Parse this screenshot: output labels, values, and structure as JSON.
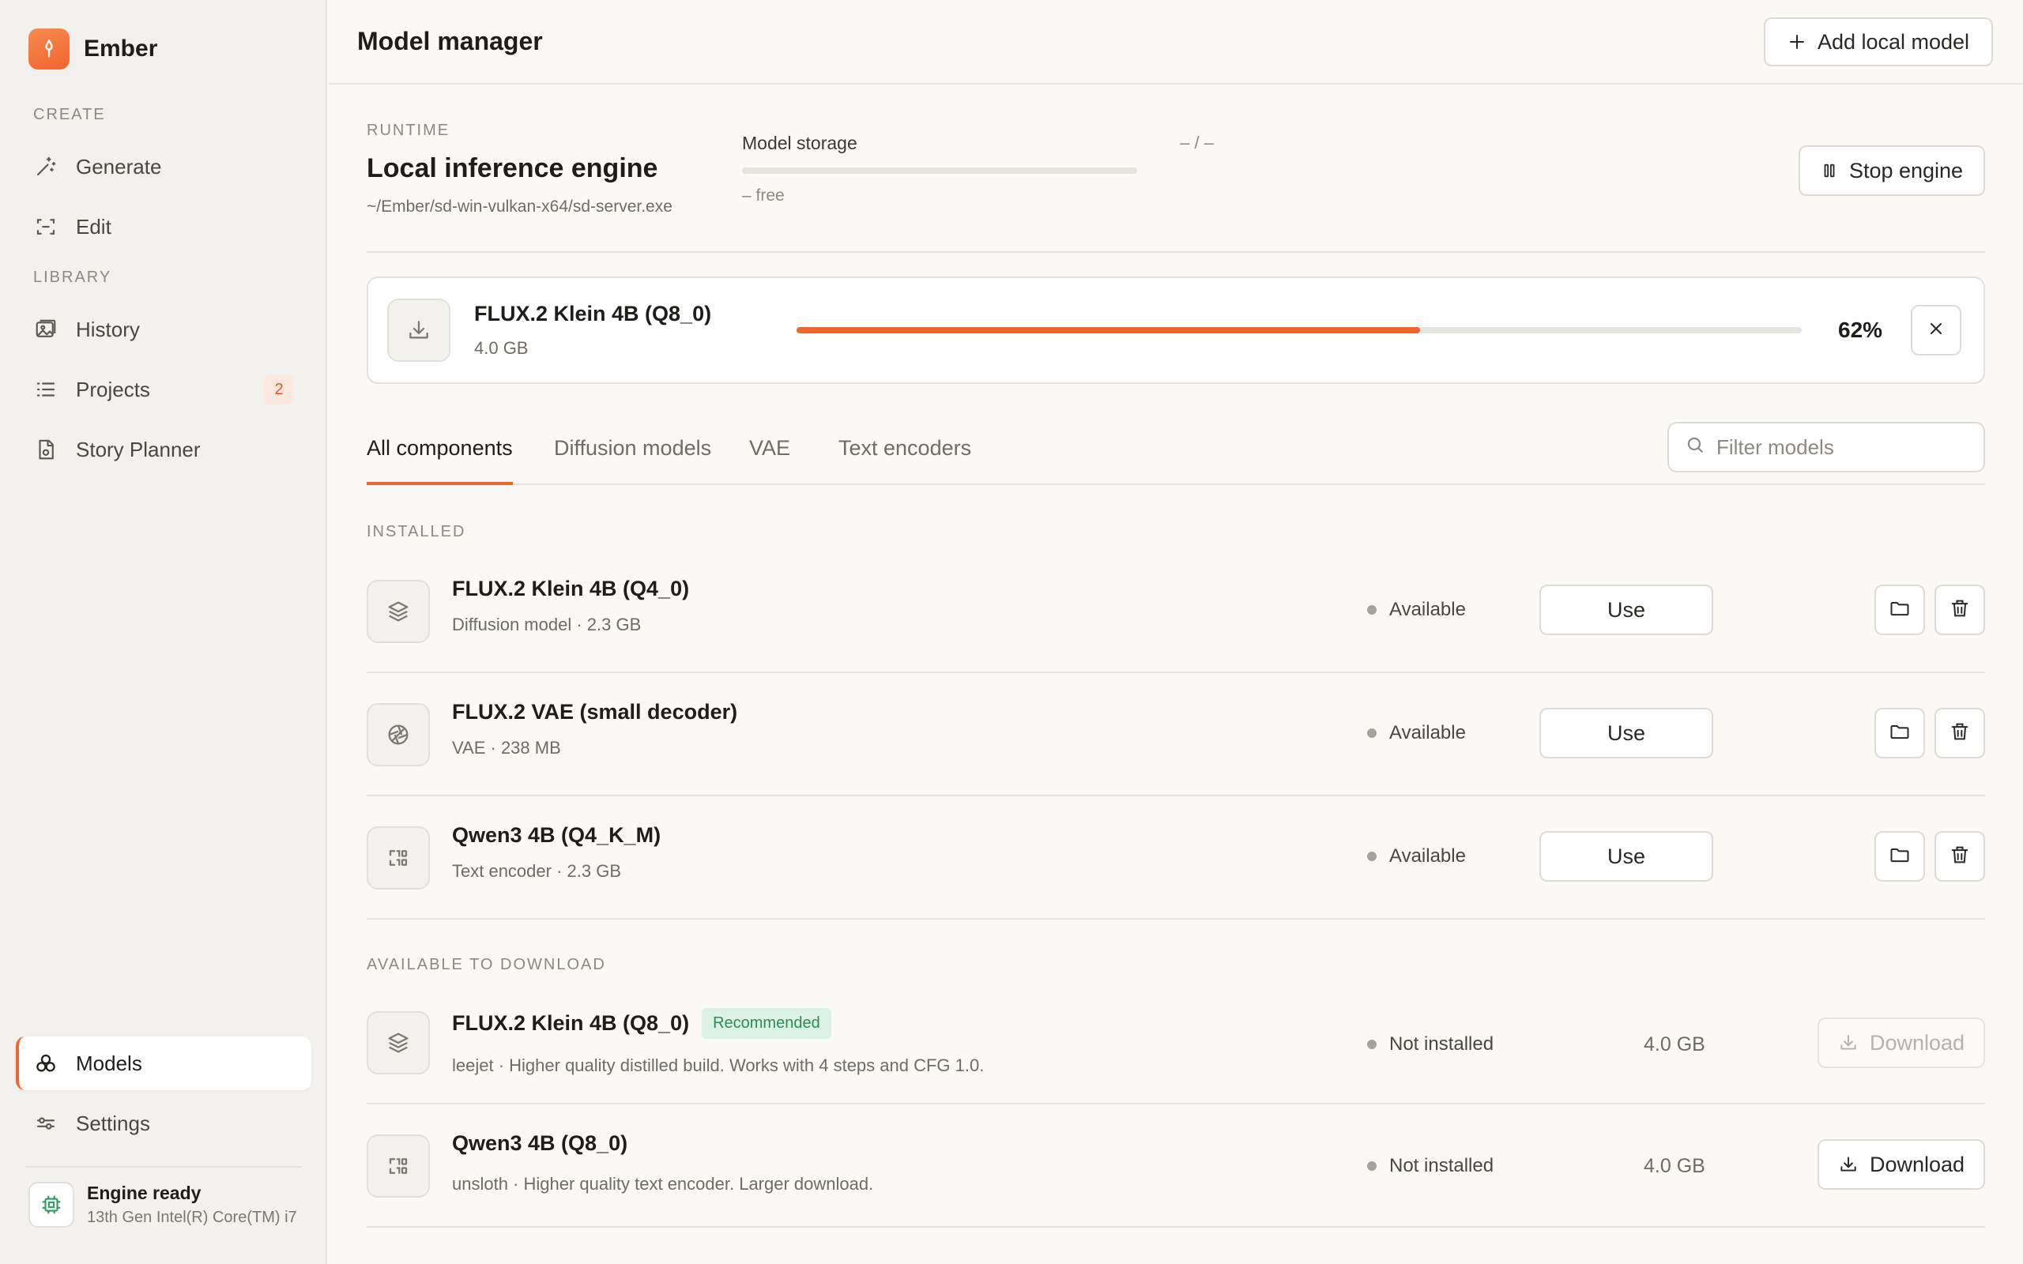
{
  "app": {
    "name": "Ember",
    "accent": "#ef6532"
  },
  "sidebar": {
    "sections": {
      "create": "CREATE",
      "library": "LIBRARY"
    },
    "items": [
      {
        "label": "Generate",
        "icon": "magic-wand-icon"
      },
      {
        "label": "Edit",
        "icon": "crop-edit-icon"
      },
      {
        "label": "History",
        "icon": "image-icon"
      },
      {
        "label": "Projects",
        "icon": "list-icon",
        "badge": "2"
      },
      {
        "label": "Story Planner",
        "icon": "document-icon"
      },
      {
        "label": "Models",
        "icon": "components-icon",
        "active": true
      },
      {
        "label": "Settings",
        "icon": "sliders-icon"
      }
    ],
    "engine": {
      "title": "Engine ready",
      "subtitle": "13th Gen Intel(R) Core(TM) i7"
    }
  },
  "header": {
    "title": "Model manager",
    "add_button": "Add local model"
  },
  "runtime": {
    "label": "RUNTIME",
    "title": "Local inference engine",
    "path": "~/Ember/sd-win-vulkan-x64/sd-server.exe",
    "storage_label": "Model storage",
    "storage_value": "– / –",
    "storage_free": "– free",
    "stop_button": "Stop engine"
  },
  "download": {
    "name": "FLUX.2 Klein 4B (Q8_0)",
    "size": "4.0 GB",
    "progress": 62,
    "progress_label": "62%"
  },
  "tabs": [
    {
      "label": "All components",
      "active": true
    },
    {
      "label": "Diffusion models"
    },
    {
      "label": "VAE"
    },
    {
      "label": "Text encoders"
    }
  ],
  "filter": {
    "placeholder": "Filter models"
  },
  "installed": {
    "label": "INSTALLED",
    "items": [
      {
        "name": "FLUX.2 Klein 4B (Q4_0)",
        "meta": "Diffusion model · 2.3 GB",
        "status": "Available",
        "action": "Use",
        "icon": "layers-icon"
      },
      {
        "name": "FLUX.2 VAE (small decoder)",
        "meta": "VAE · 238 MB",
        "status": "Available",
        "action": "Use",
        "icon": "aperture-icon"
      },
      {
        "name": "Qwen3 4B (Q4_K_M)",
        "meta": "Text encoder · 2.3 GB",
        "status": "Available",
        "action": "Use",
        "icon": "text-encoder-icon"
      }
    ]
  },
  "available": {
    "label": "AVAILABLE TO DOWNLOAD",
    "items": [
      {
        "name": "FLUX.2 Klein 4B (Q8_0)",
        "badge": "Recommended",
        "meta": "leejet · Higher quality distilled build. Works with 4 steps and CFG 1.0.",
        "status": "Not installed",
        "size": "4.0 GB",
        "action": "Download",
        "disabled": true,
        "icon": "layers-icon"
      },
      {
        "name": "Qwen3 4B (Q8_0)",
        "meta": "unsloth · Higher quality text encoder. Larger download.",
        "status": "Not installed",
        "size": "4.0 GB",
        "action": "Download",
        "disabled": false,
        "icon": "text-encoder-icon"
      }
    ]
  }
}
